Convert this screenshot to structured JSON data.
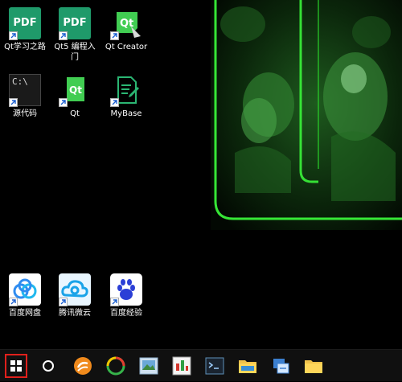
{
  "desktop_icons": [
    {
      "id": "qt-learning",
      "label": "Qt学习之路",
      "badge": "PDF"
    },
    {
      "id": "qt5-intro",
      "label": "Qt5 编程入门",
      "badge": "PDF"
    },
    {
      "id": "qt-creator",
      "label": "Qt Creator",
      "badge": "Qt"
    },
    {
      "id": "source-code",
      "label": "源代码",
      "badge": "C:\\"
    },
    {
      "id": "qt",
      "label": "Qt",
      "badge": "Qt"
    },
    {
      "id": "mybase",
      "label": "MyBase",
      "badge": ""
    },
    {
      "id": "baidu-pan",
      "label": "百度网盘",
      "badge": ""
    },
    {
      "id": "tencent-cloud",
      "label": "腾讯微云",
      "badge": ""
    },
    {
      "id": "baidu-jingyan",
      "label": "百度经验",
      "badge": ""
    }
  ],
  "taskbar": {
    "items": [
      "start-button",
      "cortana-search",
      "uc-browser",
      "360-security",
      "photo-viewer",
      "app-graph",
      "terminal",
      "file-explorer",
      "network-app",
      "folder"
    ]
  },
  "colors": {
    "accent_green": "#3cff3c",
    "taskbar": "#101010",
    "start_outline": "#e0201c"
  }
}
